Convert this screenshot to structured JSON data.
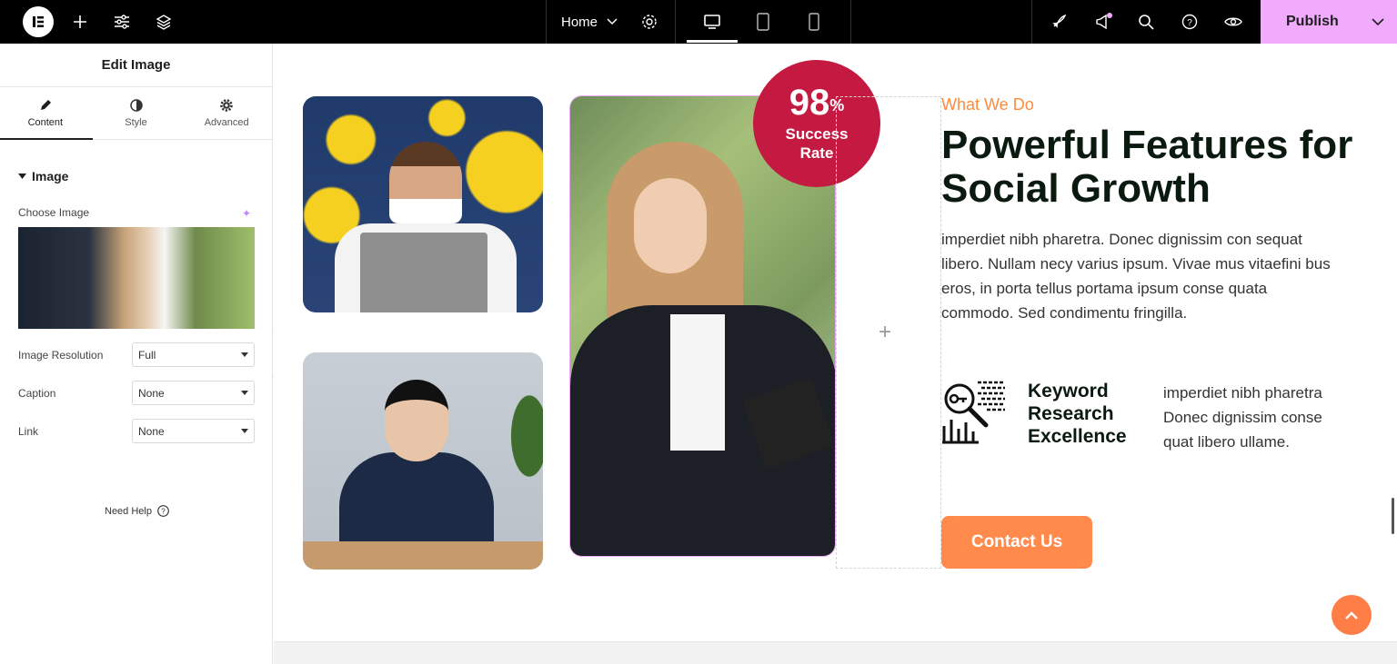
{
  "topbar": {
    "page_selector": "Home",
    "publish_label": "Publish",
    "icons": [
      "elementor-logo-icon",
      "plus-icon",
      "sliders-icon",
      "layers-icon",
      "settings-gear-icon",
      "desktop-icon",
      "tablet-icon",
      "mobile-icon",
      "rocket-icon",
      "megaphone-icon",
      "search-icon",
      "help-icon",
      "eye-icon",
      "chevron-down-icon"
    ]
  },
  "panel": {
    "title": "Edit Image",
    "tabs": [
      {
        "label": "Content",
        "icon": "pencil-icon"
      },
      {
        "label": "Style",
        "icon": "half-circle-icon"
      },
      {
        "label": "Advanced",
        "icon": "gear-icon"
      }
    ],
    "section": "Image",
    "choose_image_label": "Choose Image",
    "fields": [
      {
        "label": "Image Resolution",
        "value": "Full"
      },
      {
        "label": "Caption",
        "value": "None"
      },
      {
        "label": "Link",
        "value": "None"
      }
    ],
    "need_help": "Need Help"
  },
  "canvas": {
    "badge": {
      "number": "98",
      "unit": "%",
      "label_line1": "Success",
      "label_line2": "Rate"
    },
    "eyebrow": "What We Do",
    "heading": "Powerful Features for Social Growth",
    "paragraph": "imperdiet nibh pharetra. Donec dignissim con sequat libero. Nullam necy varius ipsum. Vivae mus vitaefini bus eros, in porta tellus portama ipsum conse quata commodo. Sed condimentu fringilla.",
    "feature": {
      "title": "Keyword Research Excellence",
      "text": "imperdiet nibh pharetra Donec dignissim conse quat libero ullame."
    },
    "contact_button": "Contact Us"
  },
  "colors": {
    "accent_orange": "#ff8a4c",
    "badge_red": "#c41a42",
    "publish_pink": "#f0abfc",
    "heading_dark": "#0b1a0f"
  }
}
